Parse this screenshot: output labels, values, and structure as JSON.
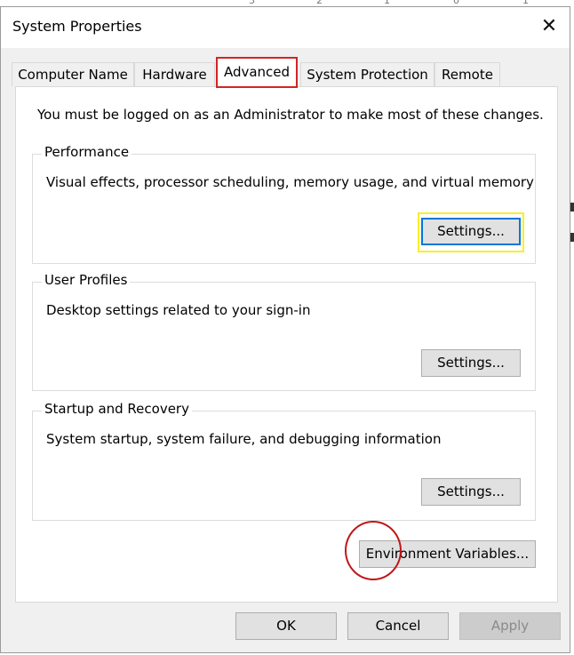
{
  "dialog": {
    "title": "System Properties",
    "close_symbol": "✕"
  },
  "tabs": [
    {
      "label": "Computer Name"
    },
    {
      "label": "Hardware"
    },
    {
      "label": "Advanced",
      "active": true
    },
    {
      "label": "System Protection"
    },
    {
      "label": "Remote"
    }
  ],
  "panel": {
    "admin_note": "You must be logged on as an Administrator to make most of these changes.",
    "groups": {
      "performance": {
        "title": "Performance",
        "description": "Visual effects, processor scheduling, memory usage, and virtual memory",
        "button": "Settings..."
      },
      "user_profiles": {
        "title": "User Profiles",
        "description": "Desktop settings related to your sign-in",
        "button": "Settings..."
      },
      "startup_recovery": {
        "title": "Startup and Recovery",
        "description": "System startup, system failure, and debugging information",
        "button": "Settings..."
      }
    },
    "env_button": "Environment Variables..."
  },
  "footer": {
    "ok": "OK",
    "cancel": "Cancel",
    "apply": "Apply"
  },
  "background": {
    "numbers": [
      "3",
      "2",
      "1",
      "0",
      "1"
    ]
  },
  "colors": {
    "active_tab_highlight": "#d42424",
    "focused_button_highlight": "#f7f026",
    "annotation_circle": "#c01818",
    "focus_border": "#0078d7"
  }
}
